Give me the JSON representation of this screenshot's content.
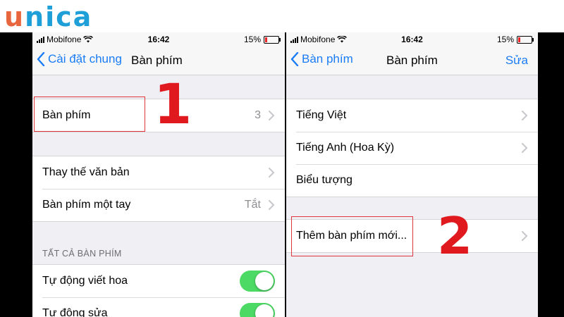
{
  "logo": {
    "first": "u",
    "rest": "nica"
  },
  "status": {
    "carrier": "Mobifone",
    "time": "16:42",
    "battery": "15%"
  },
  "left": {
    "nav": {
      "back_label": "Cài đặt chung",
      "title": "Bàn phím"
    },
    "group1": [
      {
        "label": "Bàn phím",
        "value": "3"
      }
    ],
    "group2": [
      {
        "label": "Thay thế văn bản",
        "value": ""
      },
      {
        "label": "Bàn phím một tay",
        "value": "Tắt"
      }
    ],
    "section_header": "TẤT CẢ BÀN PHÍM",
    "toggles": [
      {
        "label": "Tự động viết hoa",
        "on": true
      },
      {
        "label": "Tự động sửa",
        "on": true
      }
    ],
    "step_marker": "1"
  },
  "right": {
    "nav": {
      "back_label": "Bàn phím",
      "title": "Bàn phím",
      "action_label": "Sửa"
    },
    "group1": [
      {
        "label": "Tiếng Việt"
      },
      {
        "label": "Tiếng Anh (Hoa Kỳ)"
      },
      {
        "label": "Biểu tượng"
      }
    ],
    "group2": [
      {
        "label": "Thêm bàn phím mới..."
      }
    ],
    "step_marker": "2"
  },
  "colors": {
    "ios_blue": "#1a7cf5",
    "toggle_green": "#4cd964",
    "annotation_red": "#e0191f",
    "logo_orange": "#e8663d",
    "logo_blue": "#1f9fd8"
  }
}
